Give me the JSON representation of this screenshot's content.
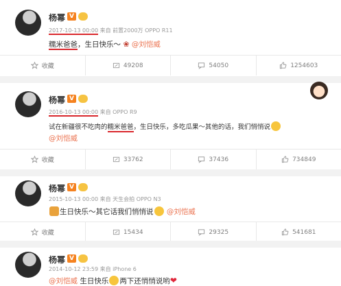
{
  "posts": [
    {
      "username": "杨幂",
      "time": "2017-10-13 00:00",
      "source": "来自 前置2000万 OPPO R11",
      "content_highlight": "糯米爸爸",
      "content_rest": "，生日快乐～",
      "mention": "@刘恺威",
      "actions": {
        "favorite": "收藏",
        "repost": "49208",
        "comment": "54050",
        "like": "1254603"
      }
    },
    {
      "username": "杨幂",
      "time": "2016-10-13 00:00",
      "source": "来自 OPPO R9",
      "content_pre": "试在新疆很不吃肉的",
      "content_highlight": "糯米爸爸",
      "content_rest": "，生日快乐，多吃瓜果～其他的话，我们悄悄说",
      "mention": "@刘恺威",
      "actions": {
        "favorite": "收藏",
        "repost": "33762",
        "comment": "37436",
        "like": "734849"
      }
    },
    {
      "username": "杨幂",
      "time": "2015-10-13 00:00",
      "source": "来自 天生会拍 OPPO N3",
      "content_rest": "生日快乐～其它话我们悄悄说",
      "mention": "@刘恺威",
      "actions": {
        "favorite": "收藏",
        "repost": "15434",
        "comment": "29325",
        "like": "541681"
      }
    },
    {
      "username": "杨幂",
      "time": "2014-10-12 23:59",
      "source": "来自 iPhone 6",
      "mention": "@刘恺威",
      "content_rest": "生日快乐",
      "content_tail": "两下还悄悄说哟"
    }
  ],
  "icons": {
    "favorite": "star-icon",
    "repost": "repost-icon",
    "comment": "comment-icon",
    "like": "thumbs-up-icon"
  },
  "colors": {
    "mention": "#eb7350",
    "underline": "#d9262b",
    "vip_badge": "#f58220",
    "separator": "#f2f2f2"
  }
}
